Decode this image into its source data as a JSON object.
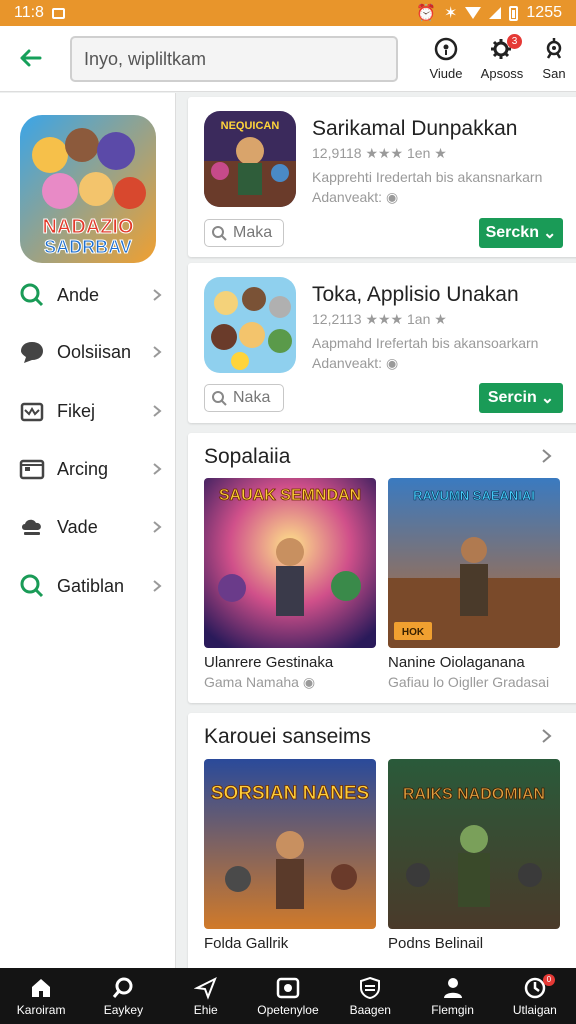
{
  "status_bar": {
    "time": "11:8",
    "battery": "1255"
  },
  "app_bar": {
    "search_value": "Inyo, wipliltkam",
    "actions": [
      {
        "label": "Viude",
        "icon": "target-icon"
      },
      {
        "label": "Apsoss",
        "icon": "settings-icon",
        "badge": "3"
      },
      {
        "label": "San",
        "icon": "bug-icon"
      }
    ]
  },
  "sidebar": {
    "feature_image_text": [
      "NADAZIO",
      "SADRBAV"
    ],
    "items": [
      {
        "label": "Ande",
        "icon": "search-icon"
      },
      {
        "label": "Oolsiisan",
        "icon": "chat-icon"
      },
      {
        "label": "Fikej",
        "icon": "crown-icon"
      },
      {
        "label": "Arcing",
        "icon": "calendar-icon"
      },
      {
        "label": "Vade",
        "icon": "cloud-icon"
      },
      {
        "label": "Gatiblan",
        "icon": "search-icon"
      }
    ]
  },
  "app_list": [
    {
      "name": "Sarikamal Dunpakkan",
      "rating": "12,9118 ★★★ 1en ★",
      "description": "Kapprehti Iredertah bis akansnarkarn",
      "developer": "Adanveakt:",
      "icon_text": "NEQUICAN",
      "preview_label": "Maka",
      "action_label": "Serckn"
    },
    {
      "name": "Toka, Applisio Unakan",
      "rating": "12,2113 ★★★ 1an ★",
      "description": "Aapmahd Irefertah bis akansoarkarn",
      "developer": "Adanveakt:",
      "icon_text": "",
      "preview_label": "Naka",
      "action_label": "Sercin"
    }
  ],
  "sections": [
    {
      "title": "Sopalaiia",
      "games": [
        {
          "name": "Ulanrere Gestinaka",
          "sub": "Gama Namaha",
          "art_title": "SAUAK SEMNDAN"
        },
        {
          "name": "Nanine Oiolaganana",
          "sub": "Gafiau lo Oigller Gradasai",
          "art_title": "RAVUMN SAEANIAI",
          "art_tag": "HOK"
        }
      ]
    },
    {
      "title": "Karouei sanseims",
      "games": [
        {
          "name": "Folda Gallrik",
          "sub": "",
          "art_title": "SORSIAN NANES"
        },
        {
          "name": "Podns Belinail",
          "sub": "",
          "art_title": "RAIKS NADOMIAN"
        }
      ]
    }
  ],
  "bottom_nav": [
    {
      "label": "Karoiram",
      "icon": "home-icon"
    },
    {
      "label": "Eaykey",
      "icon": "search-icon"
    },
    {
      "label": "Ehie",
      "icon": "send-icon"
    },
    {
      "label": "Opetenyloe",
      "icon": "camera-icon"
    },
    {
      "label": "Baagen",
      "icon": "shield-icon"
    },
    {
      "label": "Flemgin",
      "icon": "person-icon"
    },
    {
      "label": "Utlaigan",
      "icon": "clock-icon",
      "badge": "0"
    }
  ],
  "colors": {
    "status_bar": "#e8952b",
    "accent": "#1a9b57",
    "nav_bg": "#141414",
    "badge": "#e53935"
  }
}
